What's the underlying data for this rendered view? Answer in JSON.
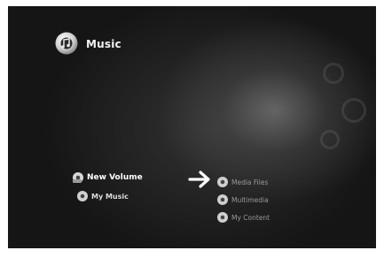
{
  "header": {
    "title": "Music",
    "icon": "music-disc-icon"
  },
  "sources": [
    {
      "label": "New Volume",
      "icon": "drive-disc-icon"
    },
    {
      "label": "My Music",
      "icon": "disc-icon"
    }
  ],
  "arrow": {
    "icon": "arrow-right-icon"
  },
  "destinations": [
    {
      "label": "Media Files",
      "icon": "disc-icon"
    },
    {
      "label": "Multimedia",
      "icon": "disc-icon"
    },
    {
      "label": "My Content",
      "icon": "disc-icon"
    }
  ],
  "colors": {
    "background": "#151515",
    "text": "#ffffff",
    "muted": "#9a9a9a"
  }
}
